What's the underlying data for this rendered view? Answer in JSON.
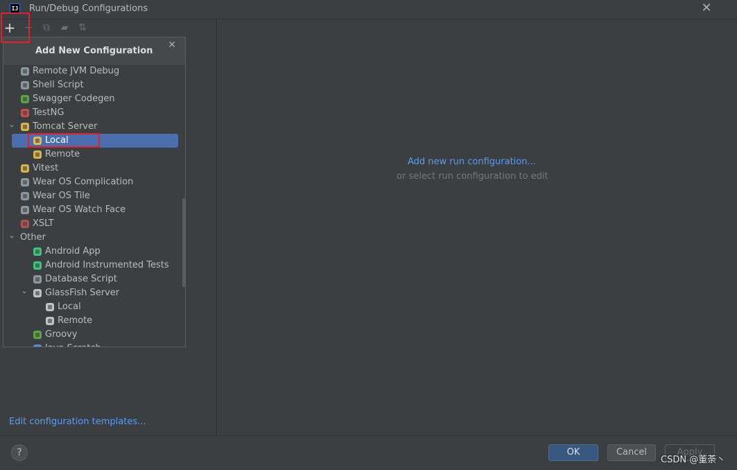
{
  "window": {
    "app_icon_text": "IJ",
    "title": "Run/Debug Configurations",
    "close_icon": "close-icon"
  },
  "toolbar": {
    "items": [
      {
        "name": "add-icon",
        "glyph": "+"
      },
      {
        "name": "remove-icon",
        "glyph": "−"
      },
      {
        "name": "copy-icon",
        "glyph": "⧉"
      },
      {
        "name": "folder-icon",
        "glyph": "▰"
      },
      {
        "name": "sort-icon",
        "glyph": "⇅"
      }
    ]
  },
  "popup": {
    "title": "Add New Configuration",
    "items": [
      {
        "label": "Remote JVM Debug",
        "icon": "remote-debug-icon",
        "color": "#9aa7b0"
      },
      {
        "label": "Shell Script",
        "icon": "shell-script-icon",
        "color": "#9aa7b0"
      },
      {
        "label": "Swagger Codegen",
        "icon": "swagger-icon",
        "color": "#62b543"
      },
      {
        "label": "TestNG",
        "icon": "testng-icon",
        "color": "#d9534f"
      },
      {
        "label": "Tomcat Server",
        "icon": "tomcat-icon",
        "color": "#f2c94c",
        "expanded": true
      },
      {
        "label": "Local",
        "icon": "tomcat-local-icon",
        "color": "#f2c94c",
        "selected": true
      },
      {
        "label": "Remote",
        "icon": "tomcat-remote-icon",
        "color": "#f2c94c"
      },
      {
        "label": "Vitest",
        "icon": "vitest-icon",
        "color": "#f2c94c"
      },
      {
        "label": "Wear OS Complication",
        "icon": "wear-os-complication-icon",
        "color": "#9aa7b0"
      },
      {
        "label": "Wear OS Tile",
        "icon": "wear-os-tile-icon",
        "color": "#9aa7b0"
      },
      {
        "label": "Wear OS Watch Face",
        "icon": "wear-os-watch-face-icon",
        "color": "#9aa7b0"
      },
      {
        "label": "XSLT",
        "icon": "xslt-icon",
        "color": "#c75450"
      },
      {
        "label": "Other",
        "icon": "",
        "expanded": true
      },
      {
        "label": "Android App",
        "icon": "android-icon",
        "color": "#3ddc84"
      },
      {
        "label": "Android Instrumented Tests",
        "icon": "android-icon",
        "color": "#3ddc84"
      },
      {
        "label": "Database Script",
        "icon": "database-script-icon",
        "color": "#9aa7b0"
      },
      {
        "label": "GlassFish Server",
        "icon": "glassfish-icon",
        "color": "#d8d8d8",
        "expanded": true
      },
      {
        "label": "Local",
        "icon": "glassfish-local-icon",
        "color": "#d8d8d8"
      },
      {
        "label": "Remote",
        "icon": "glassfish-remote-icon",
        "color": "#d8d8d8"
      },
      {
        "label": "Groovy",
        "icon": "groovy-icon",
        "color": "#62b543"
      },
      {
        "label": "Java Scratch",
        "icon": "java-scratch-icon",
        "color": "#589df6"
      }
    ]
  },
  "left_panel": {
    "edit_templates_link": "Edit configuration templates..."
  },
  "main": {
    "add_new_link": "Add new run configuration...",
    "hint": "or select run configuration to edit"
  },
  "footer": {
    "help_label": "?",
    "ok_label": "OK",
    "cancel_label": "Cancel",
    "apply_label": "Apply"
  },
  "watermark": "CSDN @董荼丶",
  "colors": {
    "background": "#3c3f41",
    "selection": "#4b6eaf",
    "link": "#589df6",
    "highlight_box": "#e5202d"
  }
}
